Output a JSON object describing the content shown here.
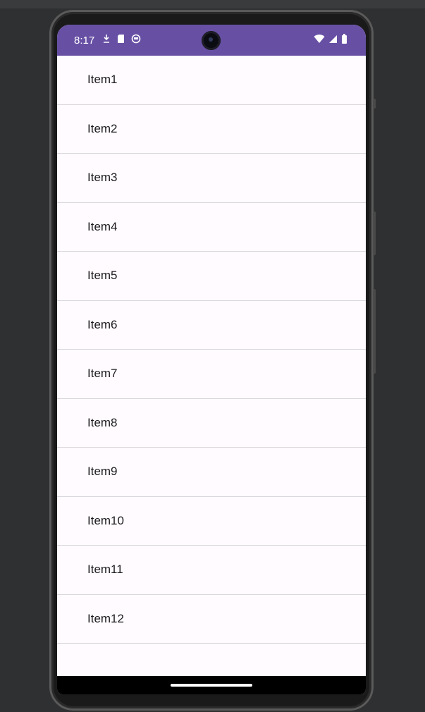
{
  "status_bar": {
    "time": "8:17",
    "color": "#6750a4",
    "left_icons": [
      "download-icon",
      "sd-card-icon",
      "notification-face-icon"
    ],
    "right_icons": [
      "wifi-icon",
      "cell-signal-icon",
      "battery-icon"
    ]
  },
  "list": {
    "items": [
      {
        "label": "Item1"
      },
      {
        "label": "Item2"
      },
      {
        "label": "Item3"
      },
      {
        "label": "Item4"
      },
      {
        "label": "Item5"
      },
      {
        "label": "Item6"
      },
      {
        "label": "Item7"
      },
      {
        "label": "Item8"
      },
      {
        "label": "Item9"
      },
      {
        "label": "Item10"
      },
      {
        "label": "Item11"
      },
      {
        "label": "Item12"
      }
    ]
  },
  "colors": {
    "background": "#fffbfe",
    "divider": "#d9d5dc",
    "text": "#1c1b1f"
  }
}
